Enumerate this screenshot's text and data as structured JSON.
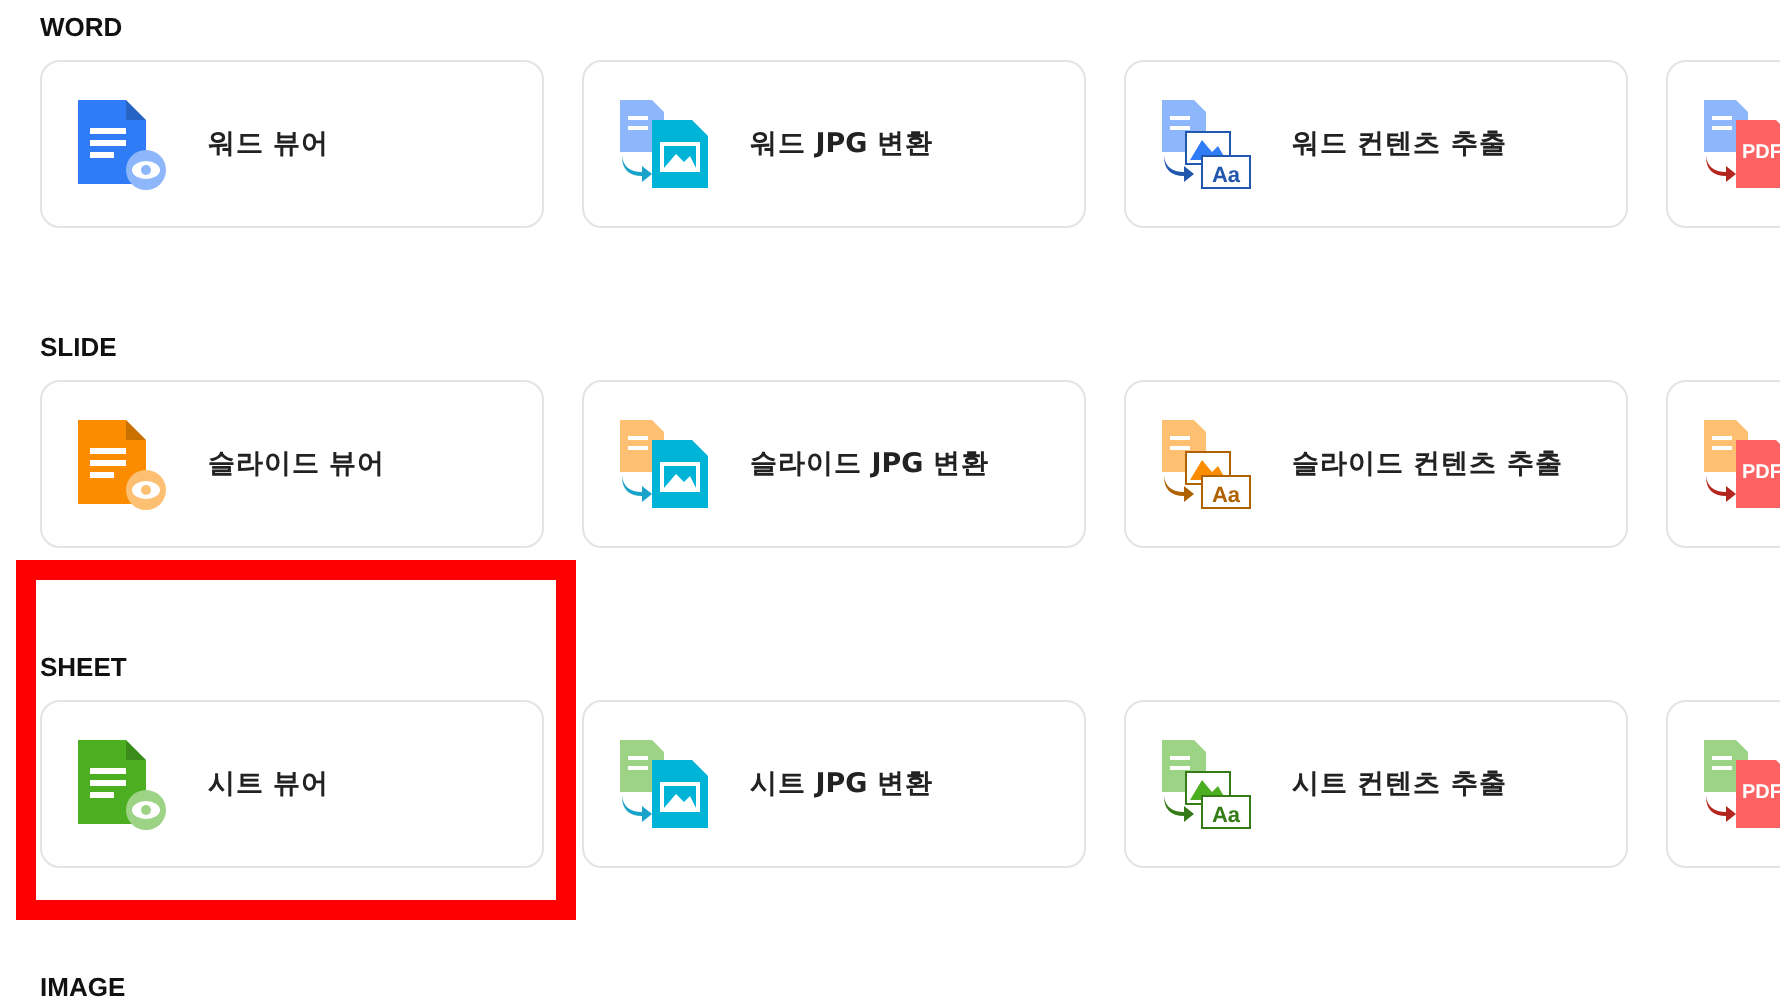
{
  "sections": [
    {
      "title": "WORD",
      "color": "#2f7cf6",
      "highlighted": false,
      "cards": [
        {
          "kind": "viewer",
          "label": "워드 뷰어"
        },
        {
          "kind": "jpg",
          "label": "워드 JPG 변환"
        },
        {
          "kind": "extract",
          "label": "워드 컨텐츠 추출",
          "icon_text": "Aa"
        },
        {
          "kind": "pdf",
          "icon_text": "PDF"
        }
      ]
    },
    {
      "title": "SLIDE",
      "color": "#fb8c00",
      "highlighted": false,
      "cards": [
        {
          "kind": "viewer",
          "label": "슬라이드 뷰어"
        },
        {
          "kind": "jpg",
          "label": "슬라이드 JPG 변환"
        },
        {
          "kind": "extract",
          "label": "슬라이드 컨텐츠 추출",
          "icon_text": "Aa"
        },
        {
          "kind": "pdf",
          "icon_text": "PDF"
        }
      ]
    },
    {
      "title": "SHEET",
      "color": "#4caf22",
      "highlighted": true,
      "cards": [
        {
          "kind": "viewer",
          "label": "시트 뷰어"
        },
        {
          "kind": "jpg",
          "label": "시트 JPG 변환"
        },
        {
          "kind": "extract",
          "label": "시트 컨텐츠 추출",
          "icon_text": "Aa"
        },
        {
          "kind": "pdf",
          "icon_text": "PDF"
        }
      ]
    },
    {
      "title": "IMAGE",
      "highlighted": false
    }
  ]
}
